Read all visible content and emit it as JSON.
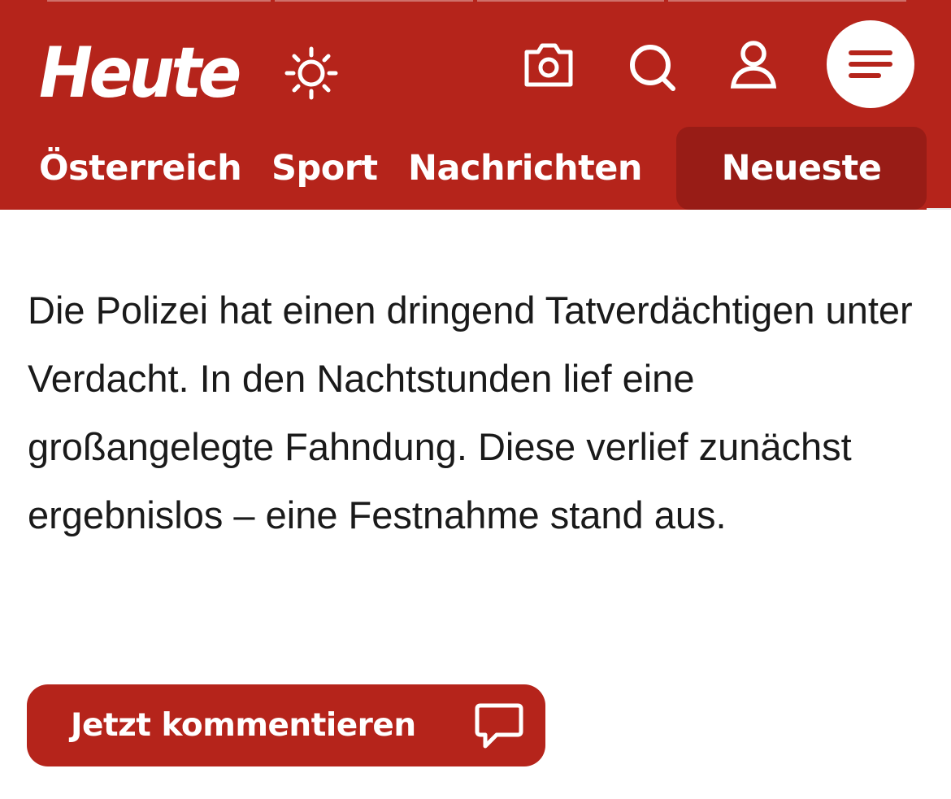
{
  "header": {
    "logo_text": "Heute",
    "brand_color": "#b5241b",
    "active_tab_color": "#981c16",
    "icons": [
      "sun-icon",
      "camera-icon",
      "search-icon",
      "user-icon",
      "menu-icon"
    ]
  },
  "nav": {
    "items": [
      {
        "label": "Österreich"
      },
      {
        "label": "Sport"
      },
      {
        "label": "Nachrichten"
      },
      {
        "label": "Neueste",
        "active": true
      }
    ]
  },
  "article": {
    "paragraph": "Die Polizei hat einen dringend Tatverdächtigen unter Verdacht. In den Nachtstunden lief eine großangelegte Fahndung. Diese verlief zunächst ergebnislos – eine Festnahme stand aus."
  },
  "comment": {
    "label": "Jetzt kommentieren",
    "icon": "comment-icon"
  }
}
